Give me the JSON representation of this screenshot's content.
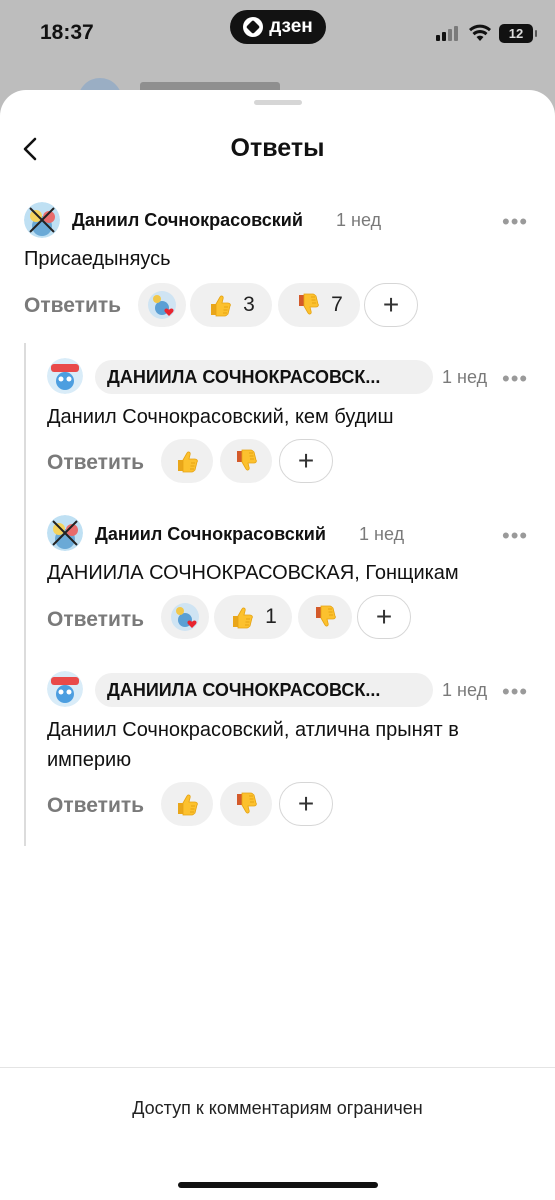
{
  "status_bar": {
    "time": "18:37",
    "app_badge": "дзен",
    "battery": "12"
  },
  "sheet": {
    "title": "Ответы"
  },
  "comments": [
    {
      "author": "Даниил Сочнокрасовский",
      "time": "1 нед",
      "text": "Присаедыняусь",
      "reply_label": "Ответить",
      "likes": "3",
      "dislikes": "7"
    },
    {
      "author": "ДАНИИЛА СОЧНОКРАСОВСК...",
      "time": "1 нед",
      "text": "Даниил Сочнокрасовский, кем будиш",
      "reply_label": "Ответить"
    },
    {
      "author": "Даниил Сочнокрасовский",
      "time": "1 нед",
      "text": "ДАНИИЛА СОЧНОКРАСОВСКАЯ, Гонщикам",
      "reply_label": "Ответить",
      "likes": "1"
    },
    {
      "author": "ДАНИИЛА СОЧНОКРАСОВСК...",
      "time": "1 нед",
      "text": "Даниил Сочнокрасовский, атлична прынят в империю",
      "reply_label": "Ответить"
    }
  ],
  "footer": {
    "notice": "Доступ к комментариям ограничен"
  },
  "icons": {
    "back": "chevron-left-icon",
    "like": "thumbs-up-icon",
    "dislike": "thumbs-down-icon",
    "add_reaction": "plus-icon",
    "more": "more-dots-icon"
  },
  "colors": {
    "accent_like": "#f5b324",
    "reaction_bg": "#f0f0f0",
    "muted_text": "#7a7a7a"
  }
}
